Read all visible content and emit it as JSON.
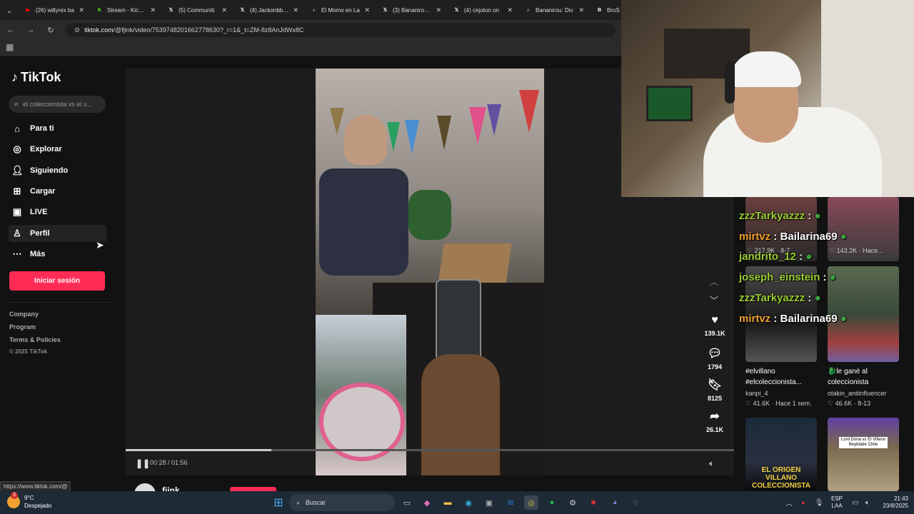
{
  "tabs": [
    {
      "label": "(26) willyrex ba",
      "icon": "youtube-icon",
      "color": "#ff0000"
    },
    {
      "label": "Stream - Kick D",
      "icon": "kick-icon",
      "color": "#53fc18"
    },
    {
      "label": "(5) Communiti",
      "icon": "x-icon",
      "color": "#ffffff"
    },
    {
      "label": "(4) Jackonbb on",
      "icon": "x-icon",
      "color": "#ffffff"
    },
    {
      "label": "El Momo en La",
      "icon": "tiktok-icon",
      "color": "#ffffff"
    },
    {
      "label": "(3) Bananirou C",
      "icon": "x-icon",
      "color": "#ffffff"
    },
    {
      "label": "(4) cejoton on",
      "icon": "x-icon",
      "color": "#ffffff"
    },
    {
      "label": "Bananirou: Div",
      "icon": "tiktok-icon",
      "color": "#ffffff"
    },
    {
      "label": "BroS",
      "icon": "bros-icon",
      "color": "#ffffff"
    }
  ],
  "address": {
    "host": "tiktok.com",
    "path": "/@fjink/video/7539748201662778630?_r=1&_t=ZM-8z8AnJdWx8C"
  },
  "sidebar": {
    "brand": "TikTok",
    "search_placeholder": "el coleccionista vs el v...",
    "items": [
      {
        "label": "Para ti",
        "icon": "home-icon"
      },
      {
        "label": "Explorar",
        "icon": "compass-icon"
      },
      {
        "label": "Siguiendo",
        "icon": "following-icon"
      },
      {
        "label": "Cargar",
        "icon": "upload-icon"
      },
      {
        "label": "LIVE",
        "icon": "live-icon"
      },
      {
        "label": "Perfil",
        "icon": "profile-icon"
      },
      {
        "label": "Más",
        "icon": "more-icon"
      }
    ],
    "login_label": "Iniciar sesión",
    "footer": [
      "Company",
      "Program",
      "Terms & Policies",
      "© 2025 TikTok"
    ]
  },
  "player": {
    "time": "00:28 / 01:56",
    "progress_fraction": 0.24,
    "author": "fjink",
    "likes": "139.1K",
    "comments": "1794",
    "saves": "8125",
    "shares": "26.1K"
  },
  "chat": [
    {
      "user": "zzzTarkyazzz",
      "msg": "",
      "color": "#9acd32"
    },
    {
      "user": "mirtvz",
      "msg": "Bailarina69",
      "color": "#f0a030"
    },
    {
      "user": "jandrito_12",
      "msg": "",
      "color": "#9acd32"
    },
    {
      "user": "joseph_einstein",
      "msg": "",
      "color": "#9acd32"
    },
    {
      "user": "zzzTarkyazzz",
      "msg": "",
      "color": "#9acd32"
    },
    {
      "user": "mirtvz",
      "msg": "Bailarina69",
      "color": "#f0a030"
    }
  ],
  "related": [
    {
      "title": "#elvillano #elcoleccionista...",
      "user": "kanpi_4",
      "likes": "41.6K",
      "age": "Hace 1 sem."
    },
    {
      "title": "le gané al coleccionista",
      "user": "otakin_antiinfluencer",
      "likes": "46.6K",
      "age": "8-13"
    },
    {
      "title": "EL ORIGEN VILLANO COLECCIONISTA",
      "user": "",
      "likes": "",
      "age": ""
    },
    {
      "title": "Lord Dona vs El Villano Beyblade Chile",
      "user": "",
      "likes": "",
      "age": ""
    }
  ],
  "related_top": {
    "likes_left": "217.9K",
    "age_left": "8-7",
    "likes_right": "143.2K",
    "age_right": "Hace..."
  },
  "status_url": "https://www.tiktok.com/@",
  "taskbar": {
    "weather_temp": "9°C",
    "weather_desc": "Despejado",
    "weather_badge": "3",
    "search_label": "Buscar",
    "lang_top": "ESP",
    "lang_bottom": "LAA",
    "clock_time": "21:43",
    "clock_date": "23/8/2025"
  }
}
